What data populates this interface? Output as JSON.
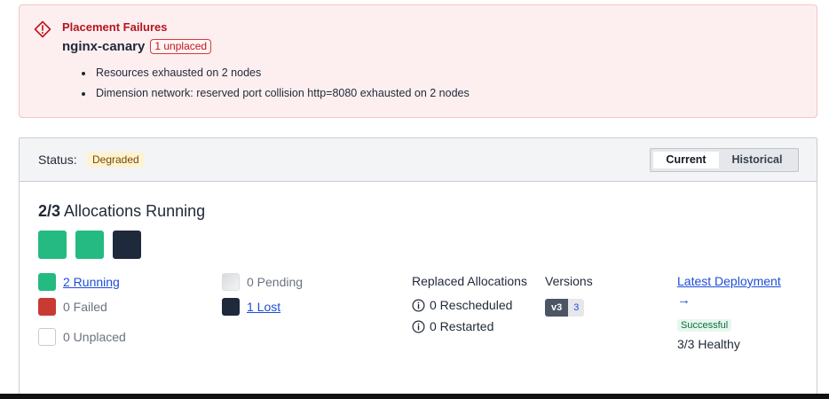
{
  "alert": {
    "title": "Placement Failures",
    "job_name": "nginx-canary",
    "unplaced_badge": "1 unplaced",
    "items": [
      "Resources exhausted on 2 nodes",
      "Dimension network: reserved port collision http=8080 exhausted on 2 nodes"
    ],
    "icon": "alert-diamond-icon"
  },
  "status": {
    "label": "Status:",
    "value": "Degraded",
    "toggle": {
      "current": "Current",
      "historical": "Historical",
      "selected": "Current"
    }
  },
  "allocations": {
    "count_text": "2/3",
    "title_text": "Allocations Running",
    "blocks": [
      "running",
      "running",
      "lost"
    ],
    "legend": {
      "running": "2 Running",
      "failed": "0 Failed",
      "unplaced": "0 Unplaced",
      "pending": "0 Pending",
      "lost": "1 Lost"
    }
  },
  "replaced": {
    "title": "Replaced Allocations",
    "rescheduled": "0 Rescheduled",
    "restarted": "0 Restarted"
  },
  "versions": {
    "title": "Versions",
    "version": "v3",
    "count": "3"
  },
  "deployment": {
    "link": "Latest Deployment",
    "arrow": "→",
    "status": "Successful",
    "healthy": "3/3 Healthy"
  },
  "colors": {
    "running": "#25ba81",
    "lost": "#1e293b",
    "failed": "#c73b32",
    "alert_red": "#b3161f",
    "link_blue": "#1d4ed8"
  }
}
